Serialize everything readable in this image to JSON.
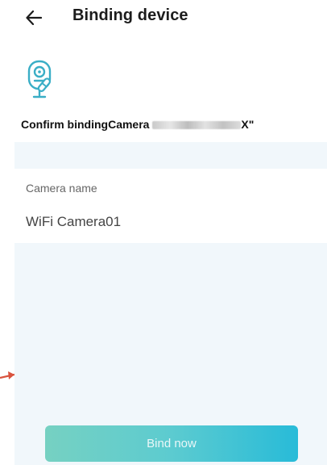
{
  "header": {
    "back_icon": "arrow-left-icon",
    "title": "Binding device"
  },
  "device": {
    "icon": "camera-icon",
    "accent_color": "#3aaec6",
    "confirm_prefix": "Confirm bindingCamera ",
    "confirm_suffix": "X\""
  },
  "form": {
    "name_label": "Camera name",
    "name_value": "WiFi Camera01"
  },
  "actions": {
    "bind_label": "Bind now"
  },
  "colors": {
    "panel_bg": "#f1f7fb",
    "button_start": "#76d1c2",
    "button_end": "#28bbd8",
    "annotation_arrow": "#d9533e"
  }
}
